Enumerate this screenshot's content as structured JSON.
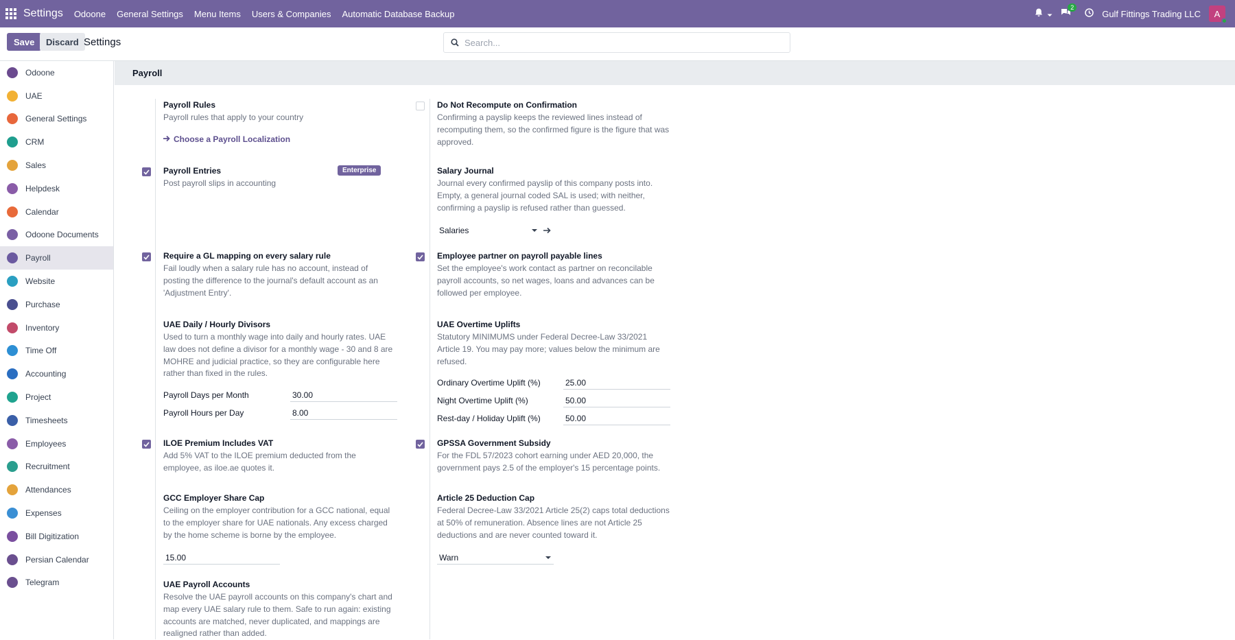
{
  "topbar": {
    "brand": "Settings",
    "menu": [
      "Odoone",
      "General Settings",
      "Menu Items",
      "Users & Companies",
      "Automatic Database Backup"
    ],
    "chat_count": "2",
    "company": "Gulf Fittings Trading LLC",
    "avatar_letter": "A"
  },
  "control": {
    "save": "Save",
    "discard": "Discard",
    "title": "Settings",
    "search_placeholder": "Search..."
  },
  "sidebar": {
    "items": [
      {
        "label": "Odoone",
        "icon": "odoone-icon",
        "color": "#6b4a8f"
      },
      {
        "label": "UAE",
        "icon": "uae-icon",
        "color": "#f2b134"
      },
      {
        "label": "General Settings",
        "icon": "general-settings-icon",
        "color": "#e8673c"
      },
      {
        "label": "CRM",
        "icon": "crm-icon",
        "color": "#1f9e8e"
      },
      {
        "label": "Sales",
        "icon": "sales-icon",
        "color": "#e4a33b"
      },
      {
        "label": "Helpdesk",
        "icon": "helpdesk-icon",
        "color": "#8a5ca8"
      },
      {
        "label": "Calendar",
        "icon": "calendar-icon",
        "color": "#e86a3a"
      },
      {
        "label": "Odoone Documents",
        "icon": "documents-icon",
        "color": "#7a5fa4"
      },
      {
        "label": "Payroll",
        "icon": "payroll-icon",
        "color": "#6b5aa0"
      },
      {
        "label": "Website",
        "icon": "website-icon",
        "color": "#2a9fc1"
      },
      {
        "label": "Purchase",
        "icon": "purchase-icon",
        "color": "#4a4f8f"
      },
      {
        "label": "Inventory",
        "icon": "inventory-icon",
        "color": "#c24b6a"
      },
      {
        "label": "Time Off",
        "icon": "time-off-icon",
        "color": "#2d8fd4"
      },
      {
        "label": "Accounting",
        "icon": "accounting-icon",
        "color": "#2a6ec1"
      },
      {
        "label": "Project",
        "icon": "project-icon",
        "color": "#1fa38f"
      },
      {
        "label": "Timesheets",
        "icon": "timesheets-icon",
        "color": "#3a5fa8"
      },
      {
        "label": "Employees",
        "icon": "employees-icon",
        "color": "#8a5ca8"
      },
      {
        "label": "Recruitment",
        "icon": "recruitment-icon",
        "color": "#2a9e8e"
      },
      {
        "label": "Attendances",
        "icon": "attendances-icon",
        "color": "#e4a33b"
      },
      {
        "label": "Expenses",
        "icon": "expenses-icon",
        "color": "#3a8fd4"
      },
      {
        "label": "Bill Digitization",
        "icon": "bill-digitization-icon",
        "color": "#7a4f9f"
      },
      {
        "label": "Persian Calendar",
        "icon": "persian-calendar-icon",
        "color": "#6a4f8f"
      },
      {
        "label": "Telegram",
        "icon": "telegram-icon",
        "color": "#6a4f8f"
      }
    ],
    "active": "Payroll"
  },
  "section": {
    "title": "Payroll",
    "payroll_rules": {
      "title": "Payroll Rules",
      "desc": "Payroll rules that apply to your country",
      "link": "Choose a Payroll Localization"
    },
    "do_not_recompute": {
      "title": "Do Not Recompute on Confirmation",
      "desc": "Confirming a payslip keeps the reviewed lines instead of recomputing them, so the confirmed figure is the figure that was approved.",
      "checked": false
    },
    "payroll_entries": {
      "title": "Payroll Entries",
      "desc": "Post payroll slips in accounting",
      "badge": "Enterprise",
      "checked": true
    },
    "salary_journal": {
      "title": "Salary Journal",
      "desc": "Journal every confirmed payslip of this company posts into. Empty, a general journal coded SAL is used; with neither, confirming a payslip is refused rather than guessed.",
      "value": "Salaries"
    },
    "gl_mapping": {
      "title": "Require a GL mapping on every salary rule",
      "desc": "Fail loudly when a salary rule has no account, instead of posting the difference to the journal's default account as an 'Adjustment Entry'.",
      "checked": true
    },
    "employee_partner": {
      "title": "Employee partner on payroll payable lines",
      "desc": "Set the employee's work contact as partner on reconcilable payroll accounts, so net wages, loans and advances can be followed per employee.",
      "checked": true
    },
    "divisors": {
      "title": "UAE Daily / Hourly Divisors",
      "desc": "Used to turn a monthly wage into daily and hourly rates. UAE law does not define a divisor for a monthly wage - 30 and 8 are MOHRE and judicial practice, so they are configurable here rather than fixed in the rules.",
      "days_label": "Payroll Days per Month",
      "days_value": "30.00",
      "hours_label": "Payroll Hours per Day",
      "hours_value": "8.00"
    },
    "overtime": {
      "title": "UAE Overtime Uplifts",
      "desc": "Statutory MINIMUMS under Federal Decree-Law 33/2021 Article 19. You may pay more; values below the minimum are refused.",
      "ordinary_label": "Ordinary Overtime Uplift (%)",
      "ordinary_value": "25.00",
      "night_label": "Night Overtime Uplift (%)",
      "night_value": "50.00",
      "rest_label": "Rest-day / Holiday Uplift (%)",
      "rest_value": "50.00"
    },
    "iloe": {
      "title": "ILOE Premium Includes VAT",
      "desc": "Add 5% VAT to the ILOE premium deducted from the employee, as iloe.ae quotes it.",
      "checked": true
    },
    "gpssa": {
      "title": "GPSSA Government Subsidy",
      "desc": "For the FDL 57/2023 cohort earning under AED 20,000, the government pays 2.5 of the employer's 15 percentage points.",
      "checked": true
    },
    "gcc_cap": {
      "title": "GCC Employer Share Cap",
      "desc": "Ceiling on the employer contribution for a GCC national, equal to the employer share for UAE nationals. Any excess charged by the home scheme is borne by the employee.",
      "value": "15.00"
    },
    "article25": {
      "title": "Article 25 Deduction Cap",
      "desc": "Federal Decree-Law 33/2021 Article 25(2) caps total deductions at 50% of remuneration. Absence lines are not Article 25 deductions and are never counted toward it.",
      "value": "Warn"
    },
    "accounts": {
      "title": "UAE Payroll Accounts",
      "desc": "Resolve the UAE payroll accounts on this company's chart and map every UAE salary rule to them. Safe to run again: existing accounts are matched, never duplicated, and mappings are realigned rather than added."
    }
  }
}
